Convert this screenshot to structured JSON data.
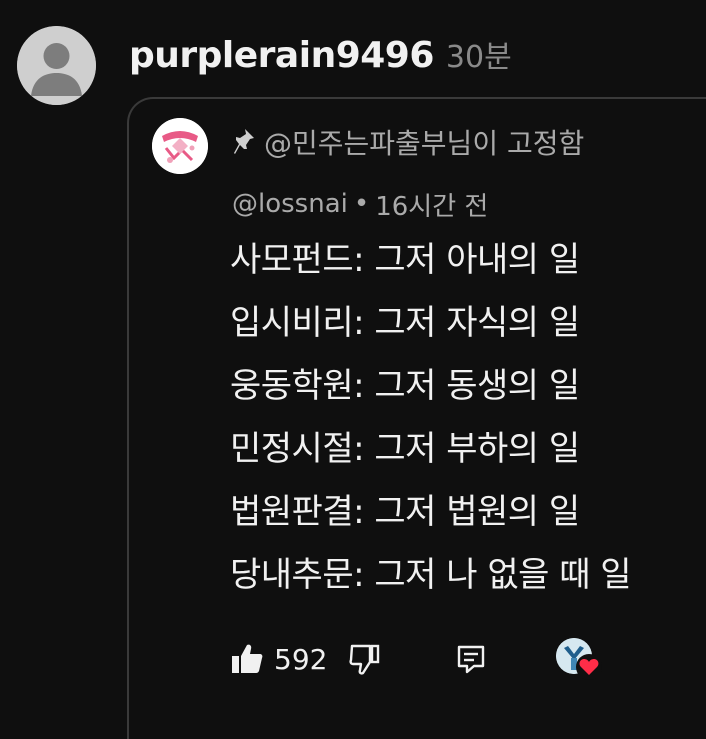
{
  "outer_comment": {
    "username": "purplerain9496",
    "time": "30분"
  },
  "quoted_comment": {
    "pinned_label": "@민주는파출부님이 고정함",
    "handle": "@lossnai",
    "separator": "•",
    "time": "16시간 전",
    "lines": [
      "사모펀드: 그저 아내의 일",
      "입시비리: 그저 자식의 일",
      "웅동학원: 그저 동생의 일",
      "민정시절: 그저 부하의 일",
      "법원판결: 그저 법원의 일",
      "당내추문: 그저 나 없을 때 일"
    ],
    "like_count": "592"
  },
  "colors": {
    "background": "#0f0f0f",
    "primary_text": "#f1f1f1",
    "secondary_text": "#aaaaaa",
    "heart": "#ff2d48"
  },
  "icons": {
    "outer_avatar": "default-avatar-icon",
    "inner_avatar": "channel-avatar-icon",
    "pin": "pin-icon",
    "like": "thumbs-up-icon",
    "dislike": "thumbs-down-icon",
    "reply": "reply-icon",
    "creator_heart": "creator-heart-icon"
  }
}
